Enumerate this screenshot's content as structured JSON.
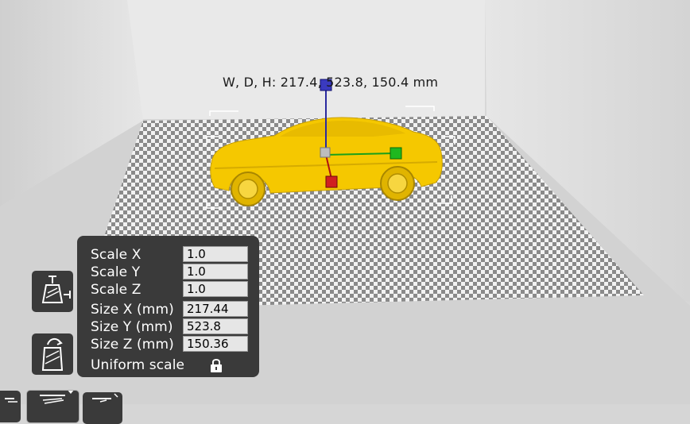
{
  "viewport": {
    "dimension_label": "W, D, H: 217.4, 523.8, 150.4 mm",
    "model_color": "#f5c800",
    "bed_color": "#8a8a8a"
  },
  "scale_panel": {
    "rows": [
      {
        "label": "Scale X",
        "value": "1.0"
      },
      {
        "label": "Scale Y",
        "value": "1.0"
      },
      {
        "label": "Scale Z",
        "value": "1.0"
      },
      {
        "label": "Size X (mm)",
        "value": "217.44"
      },
      {
        "label": "Size Y (mm)",
        "value": "523.8"
      },
      {
        "label": "Size Z (mm)",
        "value": "150.36"
      }
    ],
    "uniform_scale_label": "Uniform scale",
    "uniform_icon": "lock-icon"
  },
  "toolbar": {
    "buttons": [
      "scale-tool-icon",
      "rotate-tool-icon",
      "mirror-tool-icon",
      "support-tool-icon",
      "layflat-tool-icon"
    ]
  }
}
